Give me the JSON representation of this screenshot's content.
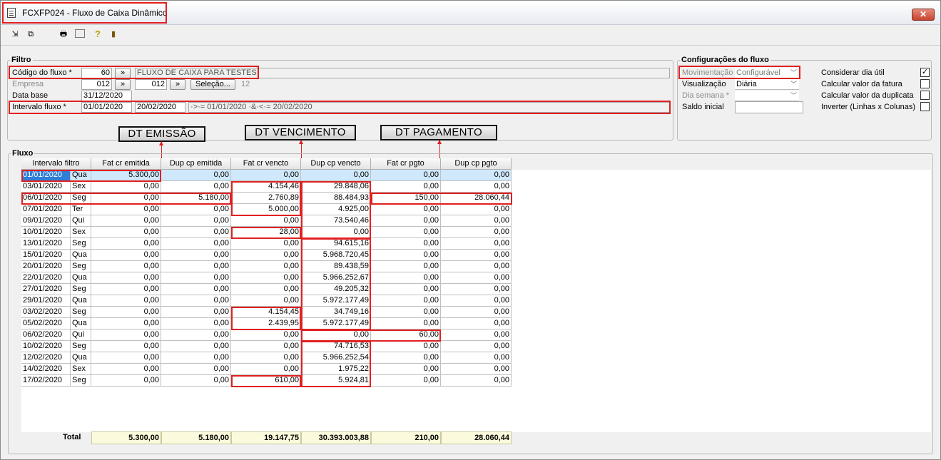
{
  "window": {
    "title": "FCXFP024 - Fluxo de Caixa Dinâmico",
    "close_label": "✕"
  },
  "toolbar": {
    "icons": [
      "exit-arrow-icon",
      "windows-icon",
      "print-icon",
      "grid-settings-icon",
      "help-icon",
      "door-exit-icon"
    ]
  },
  "filtro": {
    "legend": "Filtro",
    "codigo_label": "Código do fluxo *",
    "codigo_value": "60",
    "codigo_btn": "»",
    "codigo_desc": "FLUXO DE CAIXA PARA TESTES",
    "empresa_label": "Empresa",
    "empresa_value1": "012",
    "empresa_btn": "»",
    "empresa_value2": "012",
    "selecao_btn": "Seleção...",
    "selecao_count": "12",
    "database_label": "Data base",
    "database_value": "31/12/2020",
    "intervalo_label": "Intervalo fluxo *",
    "intervalo_inicio": "01/01/2020",
    "intervalo_fim": "20/02/2020",
    "intervalo_expr": "·>·= 01/01/2020 ·&·<·= 20/02/2020"
  },
  "config": {
    "legend": "Configurações do fluxo",
    "movimentacao_label": "Movimentação",
    "movimentacao_value": "Configurável",
    "visualizacao_label": "Visualização",
    "visualizacao_value": "Diária",
    "diasemana_label": "Dia semana *",
    "diasemana_value": "",
    "saldo_label": "Saldo inicial",
    "saldo_value": "",
    "checks": [
      {
        "label": "Considerar dia útil",
        "checked": "✓"
      },
      {
        "label": "Calcular valor da fatura",
        "checked": ""
      },
      {
        "label": "Calcular valor da duplicata",
        "checked": ""
      },
      {
        "label": "Inverter (Linhas x Colunas)",
        "checked": ""
      }
    ]
  },
  "callouts": {
    "emissao": "DT EMISSÃO",
    "vencimento": "DT VENCIMENTO",
    "pagamento": "DT PAGAMENTO"
  },
  "fluxo": {
    "legend": "Fluxo",
    "columns": [
      "Intervalo filtro",
      "Fat cr emitida",
      "Dup cp emitida",
      "Fat cr vencto",
      "Dup cp vencto",
      "Fat cr pgto",
      "Dup cp pgto"
    ],
    "rows": [
      [
        "01/01/2020",
        "Qua",
        "5.300,00",
        "0,00",
        "0,00",
        "0,00",
        "0,00",
        "0,00"
      ],
      [
        "03/01/2020",
        "Sex",
        "0,00",
        "0,00",
        "4.154,46",
        "29.848,06",
        "0,00",
        "0,00"
      ],
      [
        "06/01/2020",
        "Seg",
        "0,00",
        "5.180,00",
        "2.760,89",
        "88.484,93",
        "150,00",
        "28.060,44"
      ],
      [
        "07/01/2020",
        "Ter",
        "0,00",
        "0,00",
        "5.000,00",
        "4.925,00",
        "0,00",
        "0,00"
      ],
      [
        "09/01/2020",
        "Qui",
        "0,00",
        "0,00",
        "0,00",
        "73.540,46",
        "0,00",
        "0,00"
      ],
      [
        "10/01/2020",
        "Sex",
        "0,00",
        "0,00",
        "28,00",
        "0,00",
        "0,00",
        "0,00"
      ],
      [
        "13/01/2020",
        "Seg",
        "0,00",
        "0,00",
        "0,00",
        "94.615,16",
        "0,00",
        "0,00"
      ],
      [
        "15/01/2020",
        "Qua",
        "0,00",
        "0,00",
        "0,00",
        "5.968.720,45",
        "0,00",
        "0,00"
      ],
      [
        "20/01/2020",
        "Seg",
        "0,00",
        "0,00",
        "0,00",
        "89.438,59",
        "0,00",
        "0,00"
      ],
      [
        "22/01/2020",
        "Qua",
        "0,00",
        "0,00",
        "0,00",
        "5.966.252,67",
        "0,00",
        "0,00"
      ],
      [
        "27/01/2020",
        "Seg",
        "0,00",
        "0,00",
        "0,00",
        "49.205,32",
        "0,00",
        "0,00"
      ],
      [
        "29/01/2020",
        "Qua",
        "0,00",
        "0,00",
        "0,00",
        "5.972.177,49",
        "0,00",
        "0,00"
      ],
      [
        "03/02/2020",
        "Seg",
        "0,00",
        "0,00",
        "4.154,45",
        "34.749,16",
        "0,00",
        "0,00"
      ],
      [
        "05/02/2020",
        "Qua",
        "0,00",
        "0,00",
        "2.439,95",
        "5.972.177,49",
        "0,00",
        "0,00"
      ],
      [
        "06/02/2020",
        "Qui",
        "0,00",
        "0,00",
        "0,00",
        "0,00",
        "60,00",
        "0,00"
      ],
      [
        "10/02/2020",
        "Seg",
        "0,00",
        "0,00",
        "0,00",
        "74.716,53",
        "0,00",
        "0,00"
      ],
      [
        "12/02/2020",
        "Qua",
        "0,00",
        "0,00",
        "0,00",
        "5.966.252,54",
        "0,00",
        "0,00"
      ],
      [
        "14/02/2020",
        "Sex",
        "0,00",
        "0,00",
        "0,00",
        "1.975,22",
        "0,00",
        "0,00"
      ],
      [
        "17/02/2020",
        "Seg",
        "0,00",
        "0,00",
        "610,00",
        "5.924,81",
        "0,00",
        "0,00"
      ]
    ],
    "total_label": "Total",
    "totals": [
      "5.300,00",
      "5.180,00",
      "19.147,75",
      "30.393.003,88",
      "210,00",
      "28.060,44"
    ]
  }
}
